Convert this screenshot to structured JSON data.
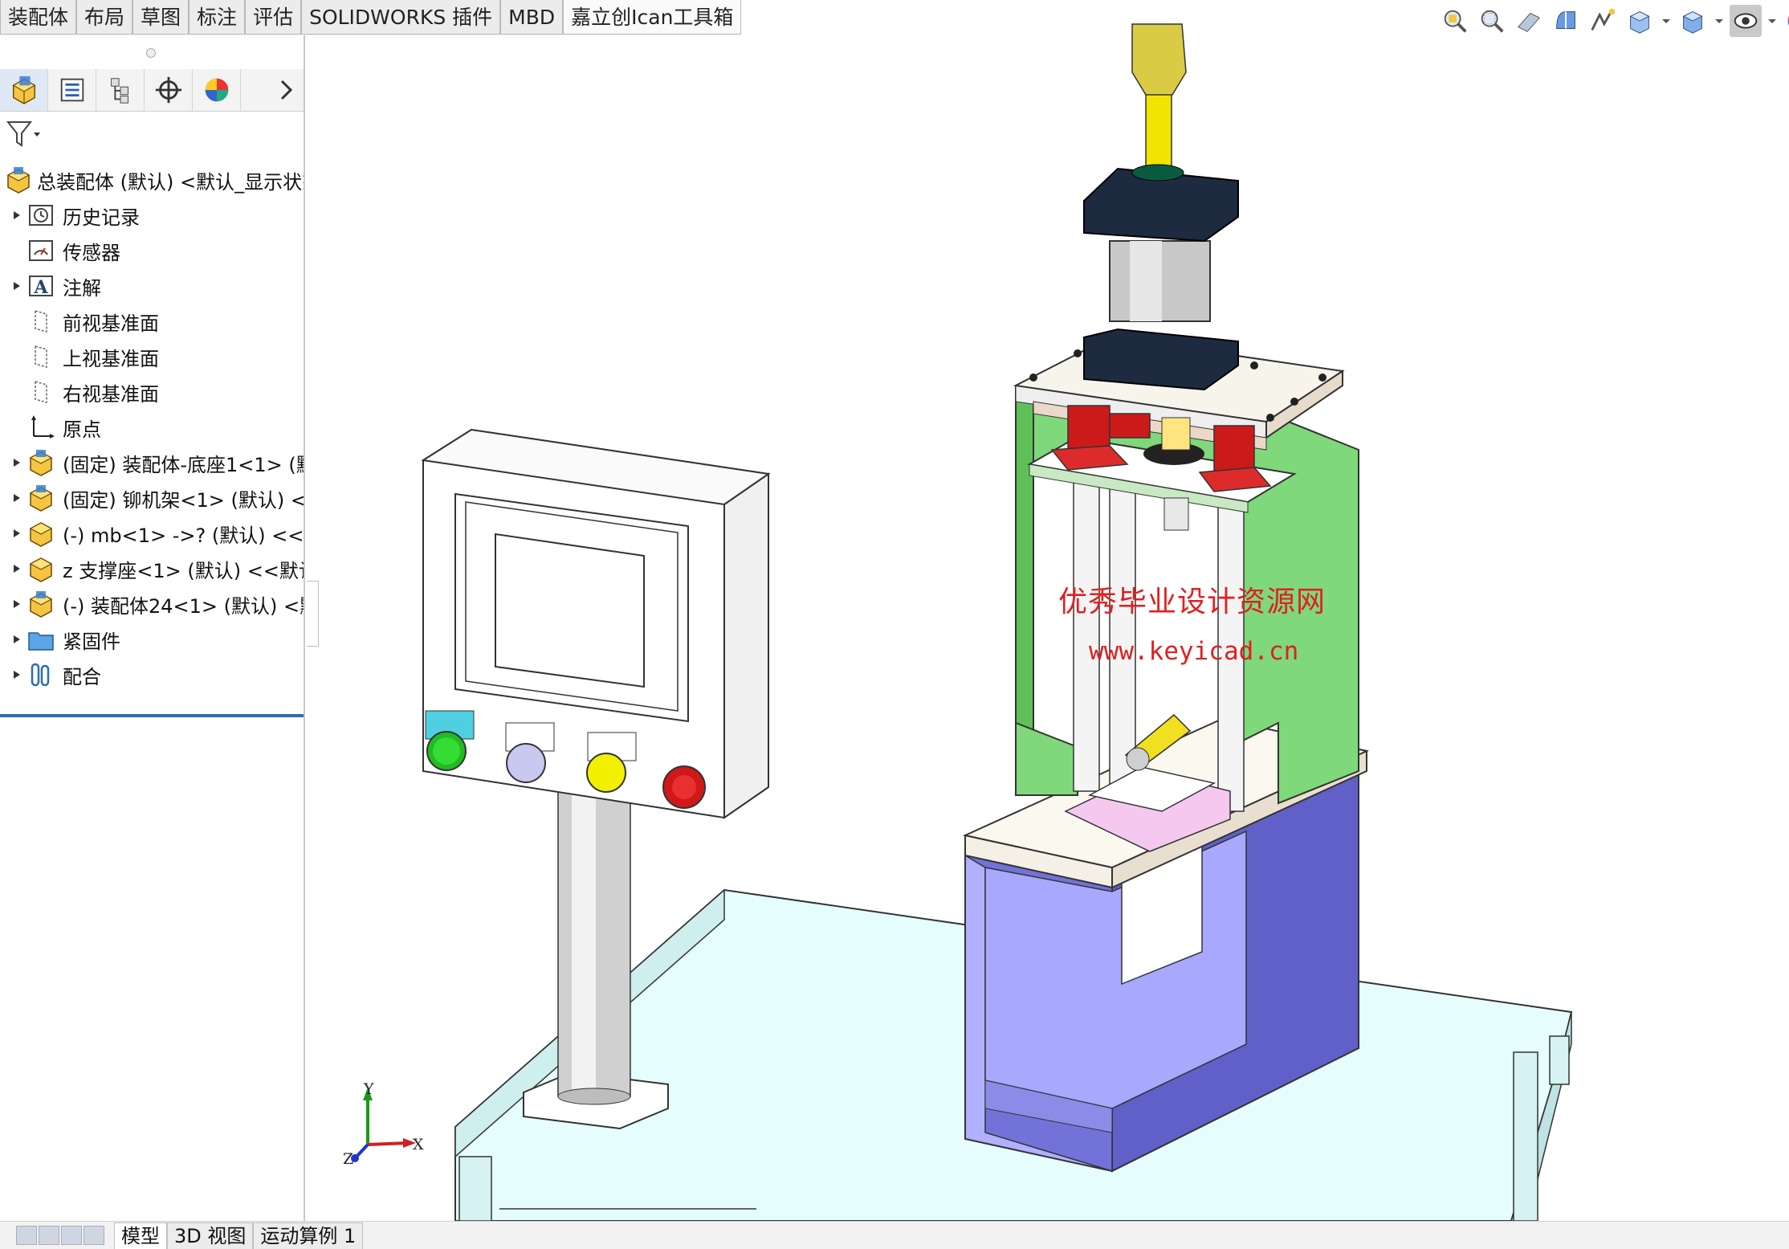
{
  "tabs": [
    "装配体",
    "布局",
    "草图",
    "标注",
    "评估",
    "SOLIDWORKS 插件",
    "MBD",
    "嘉立创Ican工具箱"
  ],
  "pane_tabs": [
    "featuremanager-icon",
    "propertymanager-icon",
    "configurationmanager-icon",
    "dimxpert-icon",
    "displaymanager-icon"
  ],
  "tree": {
    "root": "总装配体 (默认) <默认_显示状态",
    "items": [
      {
        "label": "历史记录",
        "icon": "history-icon",
        "expandable": true
      },
      {
        "label": "传感器",
        "icon": "sensor-icon",
        "expandable": false
      },
      {
        "label": "注解",
        "icon": "annotation-icon",
        "expandable": true
      },
      {
        "label": "前视基准面",
        "icon": "plane-icon",
        "expandable": false
      },
      {
        "label": "上视基准面",
        "icon": "plane-icon",
        "expandable": false
      },
      {
        "label": "右视基准面",
        "icon": "plane-icon",
        "expandable": false
      },
      {
        "label": "原点",
        "icon": "origin-icon",
        "expandable": false
      },
      {
        "label": "(固定) 装配体-底座1<1> (默",
        "icon": "assembly-icon",
        "expandable": true
      },
      {
        "label": "(固定) 铆机架<1> (默认) <",
        "icon": "assembly-icon",
        "expandable": true
      },
      {
        "label": "(-) mb<1> ->? (默认) <<默",
        "icon": "part-icon",
        "expandable": true
      },
      {
        "label": "z 支撑座<1> (默认) <<默认",
        "icon": "part-icon",
        "expandable": true
      },
      {
        "label": "(-) 装配体24<1> (默认) <默",
        "icon": "assembly-icon",
        "expandable": true
      },
      {
        "label": "紧固件",
        "icon": "folder-icon",
        "expandable": true
      },
      {
        "label": "配合",
        "icon": "mates-icon",
        "expandable": true
      }
    ]
  },
  "bottom_tabs": [
    "模型",
    "3D 视图",
    "运动算例 1"
  ],
  "watermark": {
    "line1": "优秀毕业设计资源网",
    "line2": "www.keyicad.cn"
  },
  "triad": {
    "x": "X",
    "y": "Y",
    "z": "Z"
  },
  "colors": {
    "frame_green": "#7fd87a",
    "base_purple": "#6c6cd0",
    "table_cyan": "#dffcfc",
    "cylinder_rod": "#f0e400",
    "red_blocks": "#cc1a1a"
  }
}
